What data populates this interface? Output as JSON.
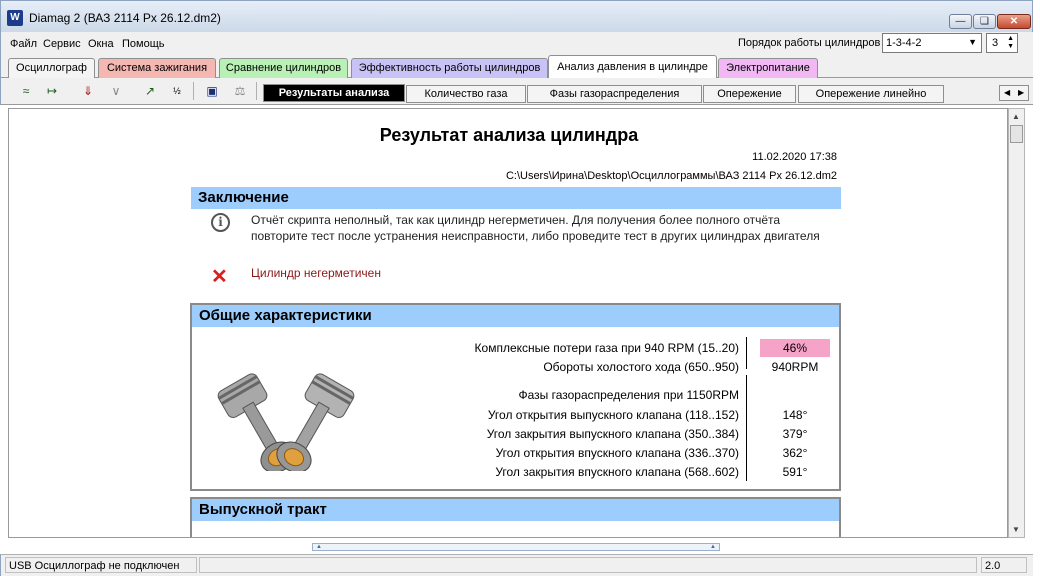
{
  "window": {
    "title": "Diamag 2 (ВАЗ 2114 Px 26.12.dm2)",
    "app_icon_glyph": "W"
  },
  "menu": {
    "items": [
      "Файл",
      "Сервис",
      "Окна",
      "Помощь"
    ],
    "order_label": "Порядок работы цилиндров",
    "order_value": "1-3-4-2",
    "cylinder_value": "3"
  },
  "tabs": [
    {
      "label": "Осциллограф",
      "color": "#f4f4f4"
    },
    {
      "label": "Система зажигания",
      "color": "#f5b7b2"
    },
    {
      "label": "Сравнение цилиндров",
      "color": "#b9f0b5"
    },
    {
      "label": "Эффективность работы цилиндров",
      "color": "#c8c3f6"
    },
    {
      "label": "Анализ давления в цилиндре",
      "color": "#ffffff"
    },
    {
      "label": "Электропитание",
      "color": "#f1b8f4"
    }
  ],
  "subtabs": [
    "Результаты анализа",
    "Количество газа",
    "Фазы газораспределения",
    "Опережение",
    "Опережение линейно"
  ],
  "report": {
    "title": "Результат анализа цилиндра",
    "date": "11.02.2020 17:38",
    "path": "C:\\Users\\Ирина\\Desktop\\Осциллограммы\\ВАЗ 2114 Px 26.12.dm2",
    "conclusion_header": "Заключение",
    "info_text": "Отчёт скрипта неполный, так как цилиндр негерметичен. Для получения более полного отчёта повторите тест после устранения неисправности, либо проведите тест в других цилиндрах двигателя",
    "error_text": "Цилиндр негерметичен",
    "general_header": "Общие характеристики",
    "params": [
      {
        "label": "Комплексные потери газа при 940 RPM (15..20)",
        "value": "46%"
      },
      {
        "label": "Обороты холостого хода (650..950)",
        "value": "940RPM"
      },
      {
        "label": "Фазы газораспределения при 1150RPM",
        "value": ""
      },
      {
        "label": "Угол открытия выпускного клапана (118..152)",
        "value": "148°"
      },
      {
        "label": "Угол закрытия выпускного клапана (350..384)",
        "value": "379°"
      },
      {
        "label": "Угол открытия впускного клапана (336..370)",
        "value": "362°"
      },
      {
        "label": "Угол закрытия впускного клапана (568..602)",
        "value": "591°"
      }
    ],
    "exhaust_header": "Выпускной тракт"
  },
  "status": {
    "left": "USB Осциллограф не подключен",
    "right": "2.0"
  }
}
